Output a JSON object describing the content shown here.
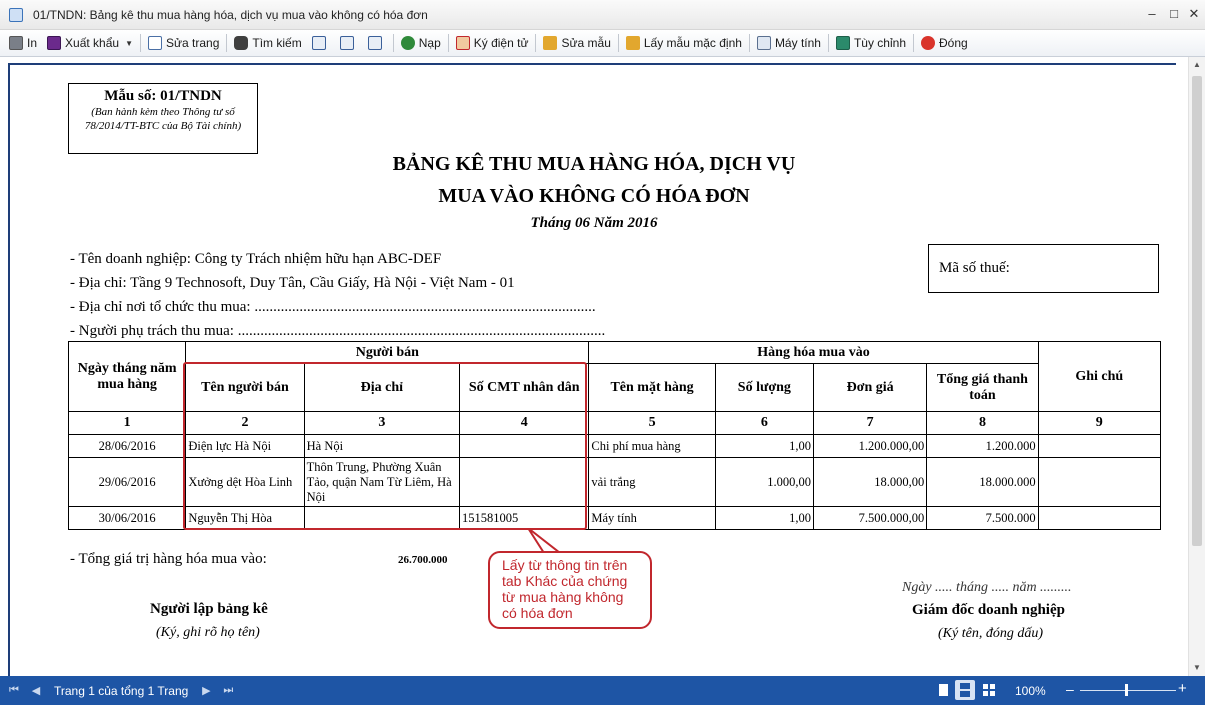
{
  "window": {
    "title": "01/TNDN: Bảng kê thu mua hàng hóa, dịch vụ mua vào không có hóa đơn"
  },
  "toolbar": {
    "print": "In",
    "export": "Xuất khẩu",
    "edit_page": "Sửa trang",
    "search": "Tìm kiếm",
    "refresh": "Nạp",
    "signature": "Ký điện tử",
    "edit_template": "Sửa mẫu",
    "default_template": "Lấy mẫu mặc định",
    "calculator": "Máy tính",
    "customize": "Tùy chỉnh",
    "close": "Đóng"
  },
  "report": {
    "form_code": "Mẫu số: 01/TNDN",
    "form_note": "(Ban hành kèm theo Thông tư số 78/2014/TT-BTC của Bộ Tài chính)",
    "title_line1": "BẢNG KÊ THU MUA HÀNG HÓA, DỊCH VỤ",
    "title_line2": "MUA VÀO KHÔNG CÓ HÓA ĐƠN",
    "period": "Tháng 06 Năm 2016",
    "company_line": "- Tên doanh nghiệp: Công ty Trách nhiệm hữu hạn ABC-DEF",
    "address_line": "- Địa chỉ: Tầng 9 Technosoft, Duy Tân, Cầu Giấy, Hà Nội - Việt Nam - 01",
    "purchase_place_line": "- Địa chỉ nơi tổ chức thu mua: ...........................................................................................",
    "purchaser_line": "- Người phụ trách thu mua: ..................................................................................................",
    "tax_code_label": "Mã số thuế:",
    "table": {
      "col_date": "Ngày tháng năm mua hàng",
      "group_seller": "Người bán",
      "group_goods": "Hàng hóa mua vào",
      "col_seller_name": "Tên người bán",
      "col_address": "Địa chỉ",
      "col_id": "Số CMT nhân dân",
      "col_item": "Tên mặt hàng",
      "col_qty": "Số lượng",
      "col_price": "Đơn giá",
      "col_total": "Tổng giá thanh toán",
      "col_note": "Ghi chú",
      "col_numbers": [
        "1",
        "2",
        "3",
        "4",
        "5",
        "6",
        "7",
        "8",
        "9"
      ],
      "rows": [
        {
          "date": "28/06/2016",
          "seller": "Điện lực Hà Nội",
          "address": "Hà Nội",
          "id": "",
          "item": "Chi phí mua hàng",
          "qty": "1,00",
          "price": "1.200.000,00",
          "total": "1.200.000",
          "note": ""
        },
        {
          "date": "29/06/2016",
          "seller": "Xưởng dệt Hòa Linh",
          "address": "Thôn Trung, Phường Xuân Tảo, quận Nam Từ Liêm, Hà Nội",
          "id": "",
          "item": "vải trắng",
          "qty": "1.000,00",
          "price": "18.000,00",
          "total": "18.000.000",
          "note": ""
        },
        {
          "date": "30/06/2016",
          "seller": "Nguyễn Thị Hòa",
          "address": "",
          "id": "151581005",
          "item": "Máy tính",
          "qty": "1,00",
          "price": "7.500.000,00",
          "total": "7.500.000",
          "note": ""
        }
      ]
    },
    "total_label": "- Tổng giá trị hàng hóa mua vào:",
    "total_value": "26.700.000",
    "date_line": "Ngày ..... tháng ..... năm .........",
    "preparer_title": "Người lập bảng kê",
    "preparer_note": "(Ký, ghi rõ họ tên)",
    "director_title": "Giám đốc doanh nghiệp",
    "director_note": "(Ký tên, đóng dấu)"
  },
  "callout": {
    "text": "Lấy từ thông tin trên tab Khác của chứng từ mua hàng không có hóa đơn"
  },
  "statusbar": {
    "page_info": "Trang 1 của tổng 1 Trang",
    "zoom": "100%"
  },
  "colors": {
    "status_bar": "#1e55a5",
    "highlight": "#c1272d",
    "page_border": "#1e3e79"
  }
}
